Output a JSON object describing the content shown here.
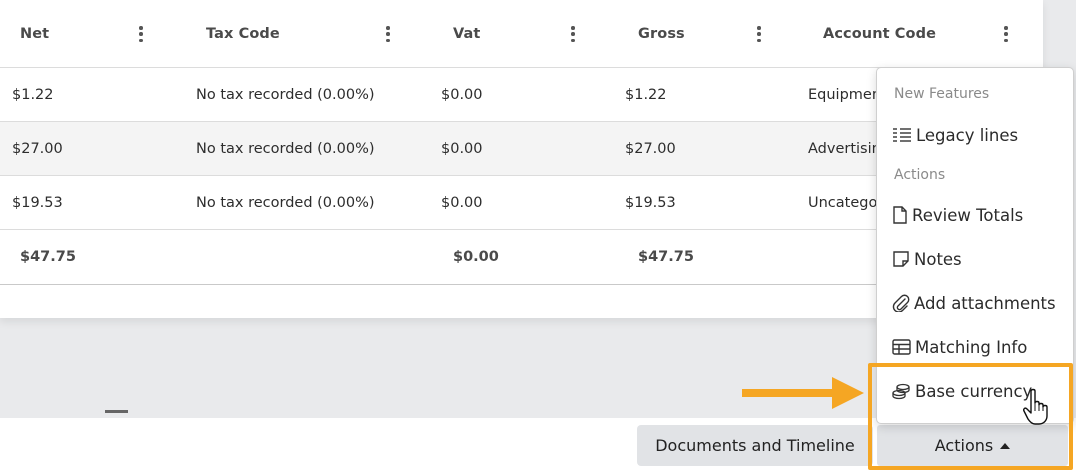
{
  "table": {
    "columns": [
      {
        "label": "Net"
      },
      {
        "label": "Tax Code"
      },
      {
        "label": "Vat"
      },
      {
        "label": "Gross"
      },
      {
        "label": "Account Code"
      }
    ],
    "rows": [
      {
        "net": "$1.22",
        "tax_code": "No tax recorded (0.00%)",
        "vat": "$0.00",
        "gross": "$1.22",
        "account_code": "Equipment"
      },
      {
        "net": "$27.00",
        "tax_code": "No tax recorded (0.00%)",
        "vat": "$0.00",
        "gross": "$27.00",
        "account_code": "Advertising"
      },
      {
        "net": "$19.53",
        "tax_code": "No tax recorded (0.00%)",
        "vat": "$0.00",
        "gross": "$19.53",
        "account_code": "Uncategorized"
      }
    ],
    "totals": {
      "net": "$47.75",
      "vat": "$0.00",
      "gross": "$47.75"
    }
  },
  "menu": {
    "section_new": "New Features",
    "section_actions": "Actions",
    "items": [
      {
        "label": "Legacy lines",
        "icon": "list-lines-icon"
      },
      {
        "label": "Review Totals",
        "icon": "document-icon"
      },
      {
        "label": "Notes",
        "icon": "note-icon"
      },
      {
        "label": "Add attachments",
        "icon": "paperclip-icon"
      },
      {
        "label": "Matching Info",
        "icon": "table-icon"
      },
      {
        "label": "Base currency",
        "icon": "coins-icon"
      }
    ]
  },
  "footer": {
    "documents_label": "Documents and Timeline",
    "actions_label": "Actions"
  },
  "colors": {
    "highlight": "#f5a623",
    "button_bg": "#e1e3e6",
    "row_alt": "#f4f4f4"
  }
}
